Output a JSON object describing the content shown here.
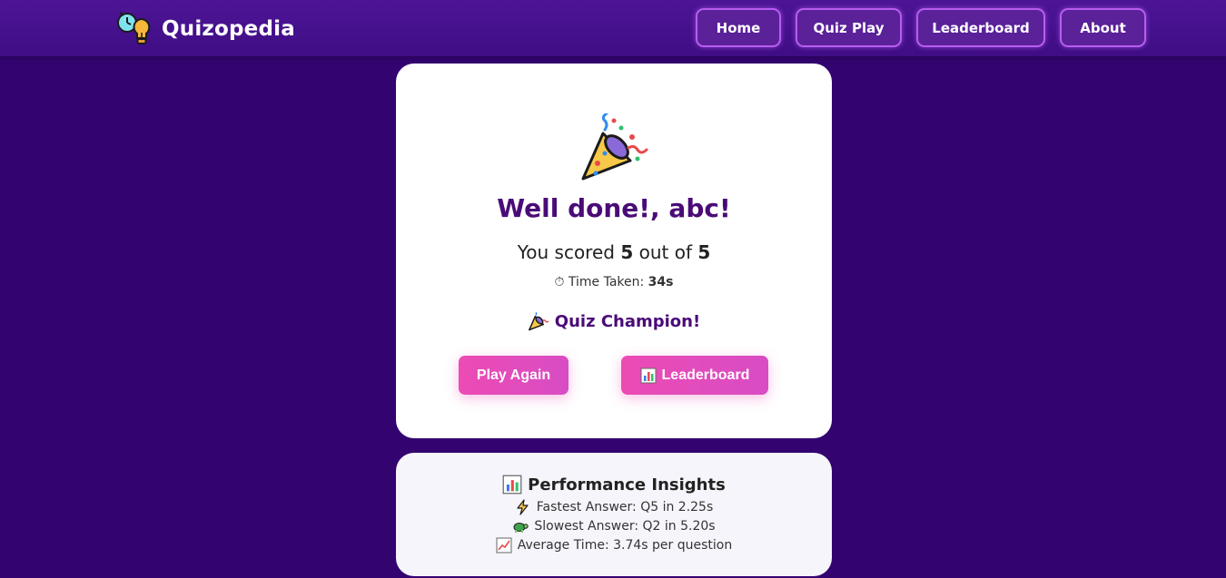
{
  "brand": {
    "name": "Quizopedia"
  },
  "nav": {
    "home": "Home",
    "quiz_play": "Quiz Play",
    "leaderboard": "Leaderboard",
    "about": "About"
  },
  "result": {
    "title": "Well done!, abc!",
    "score_prefix": "You scored",
    "score": "5",
    "score_mid": "out of",
    "total": "5",
    "time_label": "Time Taken:",
    "time_value": "34s",
    "badge": "Quiz Champion!",
    "play_again": "Play Again",
    "leaderboard_button": "Leaderboard"
  },
  "insights": {
    "title": "Performance Insights",
    "fastest": "Fastest Answer: Q5 in 2.25s",
    "slowest": "Slowest Answer: Q2 in 5.20s",
    "average": "Average Time: 3.74s per question"
  },
  "icons": {
    "brand": "bulb-clock-icon",
    "celebration": "party-popper-icon",
    "timer": "stopwatch-icon",
    "chart": "bar-chart-icon",
    "fastest": "lightning-icon",
    "slowest": "turtle-icon",
    "average": "trending-up-icon"
  },
  "colors": {
    "background": "#330470",
    "navbar": "#4d1596",
    "nav_button": "#5a2199",
    "nav_border": "#b85cf0",
    "accent_pink": "#ec4bb4",
    "title_purple": "#4a0b78"
  }
}
